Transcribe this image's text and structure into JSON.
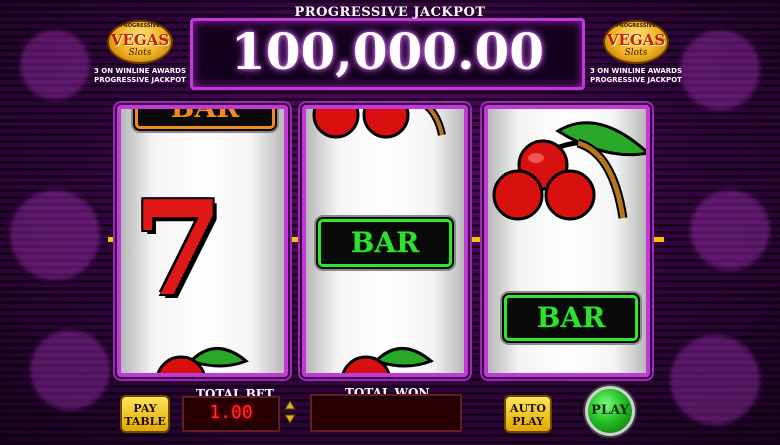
{
  "header": {
    "jackpot_label": "PROGRESSIVE JACKPOT",
    "jackpot_value": "100,000.00"
  },
  "logo": {
    "title": "VEGAS",
    "subtitle": "Slots",
    "top_text": "PROGRESSIVE",
    "line1": "3 ON WINLINE AWARDS",
    "line2": "PROGRESSIVE JACKPOT"
  },
  "reels": {
    "reel1": {
      "top_bar": "BAR",
      "symbols": [
        "bar-orange",
        "seven",
        "cherries"
      ]
    },
    "reel2": {
      "center_bar": "BAR",
      "symbols": [
        "cherries",
        "bar-green",
        "cherries"
      ]
    },
    "reel3": {
      "lower_bar": "BAR",
      "symbols": [
        "cherries",
        "bar-green"
      ]
    }
  },
  "controls": {
    "pay_table_label": "PAY TABLE",
    "total_bet_label": "TOTAL BET",
    "total_bet_value": "1.00",
    "total_won_label": "TOTAL WON",
    "total_won_value": "",
    "auto_play_label": "AUTO PLAY",
    "play_label": "PLAY"
  },
  "colors": {
    "frame": "#c13ad6",
    "bar_green": "#2ee62e",
    "bar_orange": "#f08a1a",
    "seven_red": "#e01818",
    "cherry_red": "#d81010",
    "leaf_green": "#2aa82a",
    "bet_digits": "#ff2a2a",
    "payline": "#f5c400"
  }
}
